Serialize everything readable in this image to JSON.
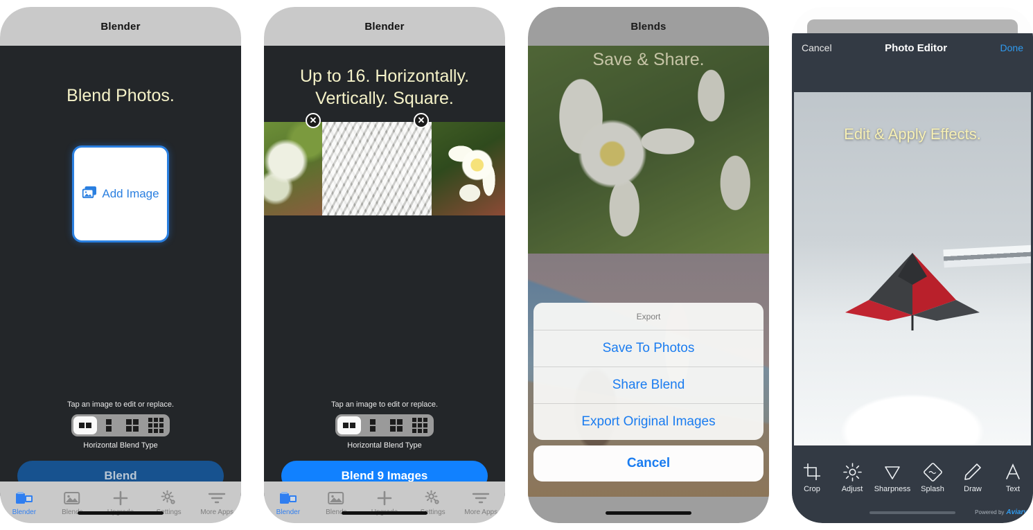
{
  "screens": [
    {
      "id": "blender-empty",
      "nav_title": "Blender",
      "headline": "Blend Photos.",
      "add_image_label": "Add Image",
      "hint": "Tap an image to edit or replace.",
      "segmented_label": "Horizontal Blend Type",
      "segments": [
        "two-horizontal",
        "two-vertical",
        "four-grid",
        "nine-grid"
      ],
      "selected_segment": 0,
      "cta_label": "Blend",
      "cta_state": "disabled"
    },
    {
      "id": "blender-filled",
      "nav_title": "Blender",
      "headline_line1": "Up to 16. Horizontally.",
      "headline_line2": "Vertically. Square.",
      "thumbnails": [
        "moss-flowers-photo",
        "stone-path-photo",
        "plumeria-flower-photo"
      ],
      "close_label": "✕",
      "hint": "Tap an image to edit or replace.",
      "segmented_label": "Horizontal Blend Type",
      "segments": [
        "two-horizontal",
        "two-vertical",
        "four-grid",
        "nine-grid"
      ],
      "selected_segment": 0,
      "cta_label": "Blend 9 Images",
      "cta_state": "active"
    },
    {
      "id": "blends-export",
      "nav_title": "Blends",
      "headline": "Save & Share.",
      "photos": [
        "plumeria-flower-photo",
        "eiffel-bridge-blend-photo"
      ],
      "sheet": {
        "title": "Export",
        "items": [
          "Save To Photos",
          "Share Blend",
          "Export Original Images"
        ],
        "cancel": "Cancel"
      }
    },
    {
      "id": "photo-editor",
      "nav": {
        "cancel": "Cancel",
        "title": "Photo Editor",
        "done": "Done"
      },
      "caption": "Edit & Apply Effects.",
      "photo": "red-umbrella-in-snow-photo",
      "tools": [
        {
          "label": "Crop",
          "icon": "crop-icon"
        },
        {
          "label": "Adjust",
          "icon": "brightness-icon"
        },
        {
          "label": "Sharpness",
          "icon": "diamond-icon"
        },
        {
          "label": "Splash",
          "icon": "splash-icon"
        },
        {
          "label": "Draw",
          "icon": "pencil-icon"
        },
        {
          "label": "Text",
          "icon": "text-icon"
        }
      ],
      "powered_by_prefix": "Powered by",
      "powered_by_brand": "Aviary"
    }
  ],
  "tabbar": {
    "items": [
      {
        "label": "Blender",
        "icon": "blender-icon",
        "active": true
      },
      {
        "label": "Blends",
        "icon": "photo-icon",
        "active": false
      },
      {
        "label": "Upgrade",
        "icon": "plus-icon",
        "active": false
      },
      {
        "label": "Settings",
        "icon": "gear-icon",
        "active": false
      },
      {
        "label": "More Apps",
        "icon": "filter-icon",
        "active": false
      }
    ]
  },
  "colors": {
    "accent_blue": "#1181ff",
    "disabled_blue": "#17528f",
    "headline_cream": "#f5f2c8",
    "screen_dark": "#232629",
    "phone_body": "#c9c9c9",
    "editor_chrome": "#333a44",
    "link_blue": "#1a7cf0"
  }
}
